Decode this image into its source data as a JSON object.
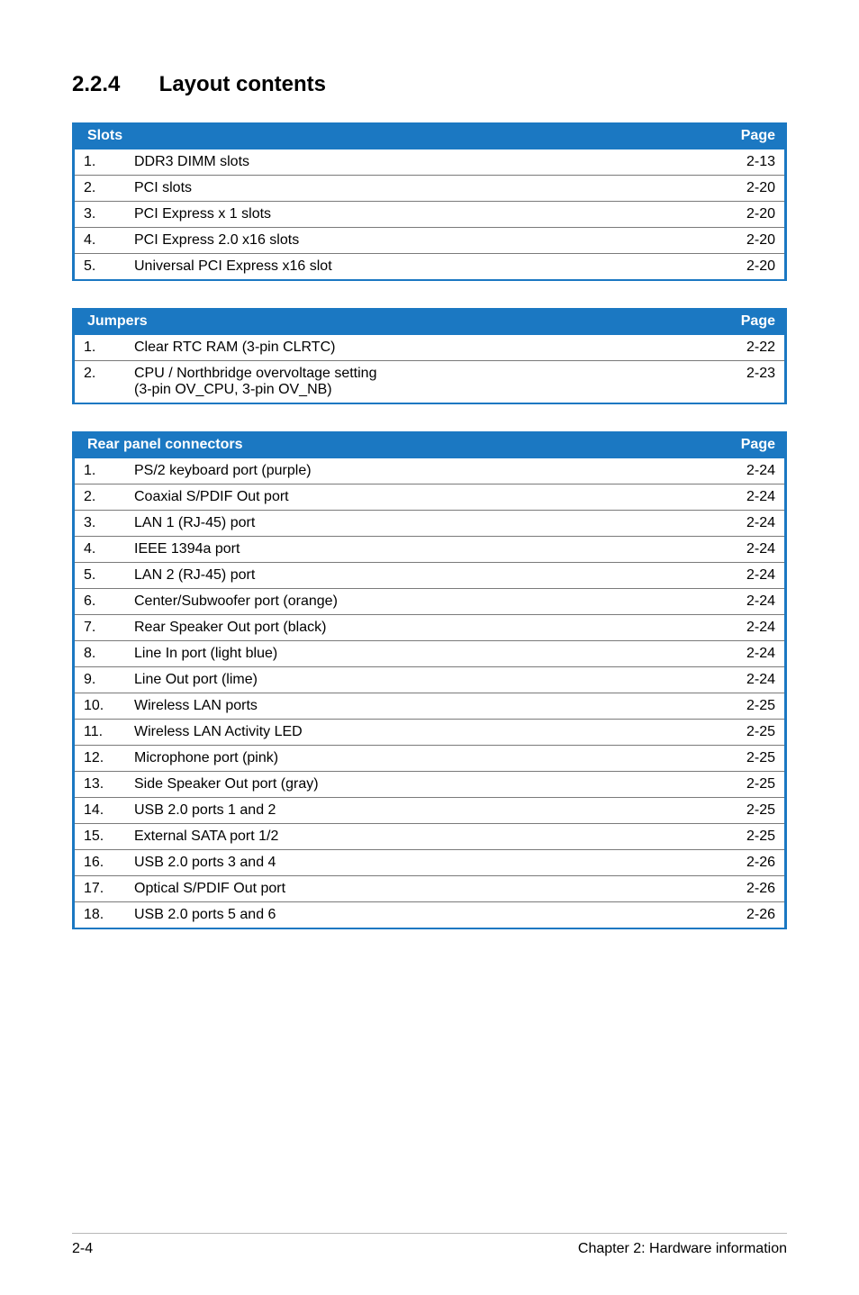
{
  "heading": {
    "number": "2.2.4",
    "title": "Layout contents"
  },
  "tables": {
    "slots": {
      "header": {
        "title": "Slots",
        "page": "Page"
      },
      "rows": [
        {
          "n": "1.",
          "desc": "DDR3 DIMM slots",
          "page": "2-13"
        },
        {
          "n": "2.",
          "desc": "PCI slots",
          "page": "2-20"
        },
        {
          "n": "3.",
          "desc": "PCI Express x 1 slots",
          "page": "2-20"
        },
        {
          "n": "4.",
          "desc": "PCI Express 2.0 x16 slots",
          "page": "2-20"
        },
        {
          "n": "5.",
          "desc": "Universal PCI Express x16 slot",
          "page": "2-20"
        }
      ]
    },
    "jumpers": {
      "header": {
        "title": "Jumpers",
        "page": "Page"
      },
      "rows": [
        {
          "n": "1.",
          "desc": "Clear RTC RAM (3-pin CLRTC)",
          "page": "2-22"
        },
        {
          "n": "2.",
          "desc": "CPU / Northbridge overvoltage setting\n(3-pin OV_CPU, 3-pin OV_NB)",
          "page": "2-23"
        }
      ]
    },
    "rear": {
      "header": {
        "title": "Rear panel connectors",
        "page": "Page"
      },
      "rows": [
        {
          "n": "1.",
          "desc": "PS/2 keyboard port (purple)",
          "page": "2-24"
        },
        {
          "n": "2.",
          "desc": "Coaxial S/PDIF Out port",
          "page": "2-24"
        },
        {
          "n": "3.",
          "desc": "LAN 1 (RJ-45) port",
          "page": "2-24"
        },
        {
          "n": "4.",
          "desc": "IEEE 1394a port",
          "page": "2-24"
        },
        {
          "n": "5.",
          "desc": "LAN 2 (RJ-45) port",
          "page": "2-24"
        },
        {
          "n": "6.",
          "desc": "Center/Subwoofer port (orange)",
          "page": "2-24"
        },
        {
          "n": "7.",
          "desc": "Rear Speaker Out port (black)",
          "page": "2-24"
        },
        {
          "n": "8.",
          "desc": "Line In port (light blue)",
          "page": "2-24"
        },
        {
          "n": "9.",
          "desc": "Line Out port (lime)",
          "page": "2-24"
        },
        {
          "n": "10.",
          "desc": "Wireless LAN ports",
          "page": "2-25"
        },
        {
          "n": "11.",
          "desc": "Wireless LAN Activity LED",
          "page": "2-25"
        },
        {
          "n": "12.",
          "desc": "Microphone port (pink)",
          "page": "2-25"
        },
        {
          "n": "13.",
          "desc": "Side Speaker Out port (gray)",
          "page": "2-25"
        },
        {
          "n": "14.",
          "desc": "USB 2.0 ports 1 and 2",
          "page": "2-25"
        },
        {
          "n": "15.",
          "desc": "External SATA port 1/2",
          "page": "2-25"
        },
        {
          "n": "16.",
          "desc": "USB 2.0 ports 3 and 4",
          "page": "2-26"
        },
        {
          "n": "17.",
          "desc": "Optical S/PDIF Out port",
          "page": "2-26"
        },
        {
          "n": "18.",
          "desc": "USB 2.0 ports 5 and 6",
          "page": "2-26"
        }
      ]
    }
  },
  "footer": {
    "left": "2-4",
    "right": "Chapter 2: Hardware information"
  }
}
